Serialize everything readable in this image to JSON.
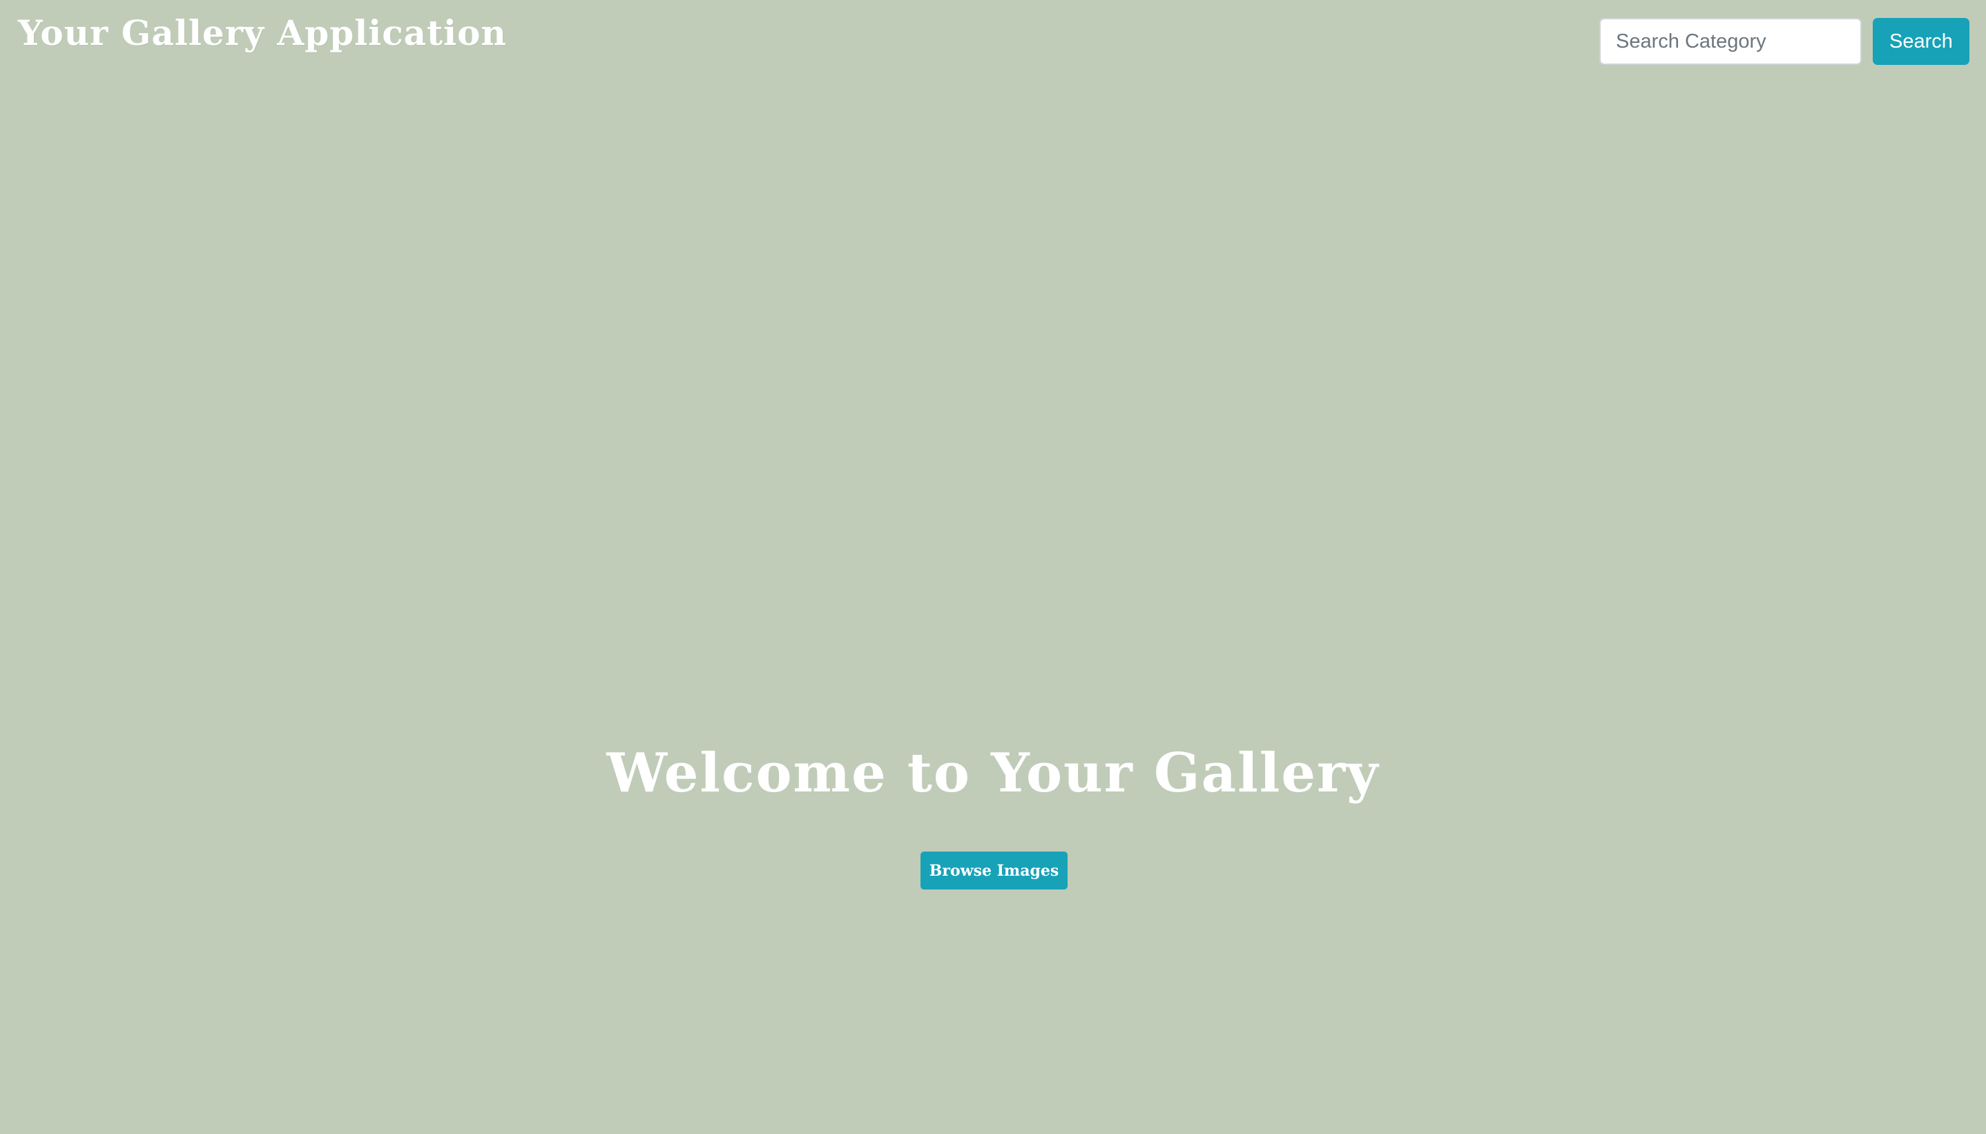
{
  "navbar": {
    "brand": "Your Gallery Application",
    "search": {
      "placeholder": "Search Category",
      "value": "",
      "button_label": "Search"
    }
  },
  "hero": {
    "title": "Welcome to Your Gallery",
    "browse_button_label": "Browse Images"
  },
  "colors": {
    "background": "#c0ccb8",
    "accent": "#17a2b8",
    "text": "#ffffff"
  }
}
